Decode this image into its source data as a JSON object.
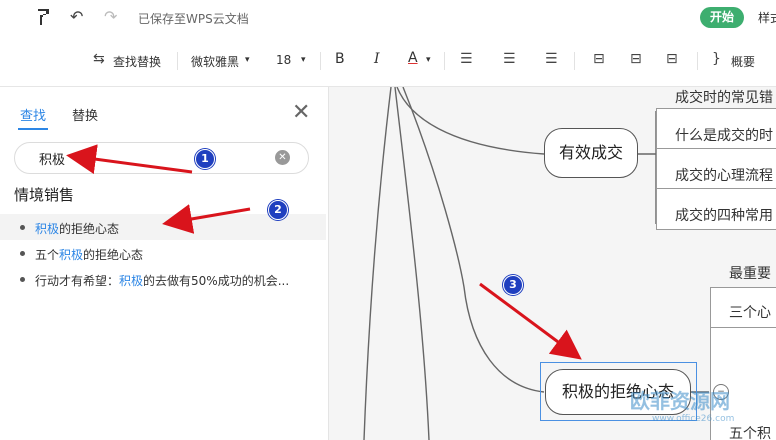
{
  "topbar": {
    "saved_status": "已保存至WPS云文档",
    "start_label": "开始",
    "style_label": "样式"
  },
  "toolbar": {
    "find_replace_label": "查找替换",
    "font_name": "微软雅黑",
    "font_size": "18",
    "bold_label": "B",
    "italic_label": "I",
    "font_color_label": "A",
    "summary_label": "概要"
  },
  "find_panel": {
    "tab_find": "查找",
    "tab_replace": "替换",
    "search_value": "积极",
    "group_title": "情境销售",
    "results": [
      {
        "before": "",
        "kw": "积极",
        "after": "的拒绝心态"
      },
      {
        "before": "五个",
        "kw": "积极",
        "after": "的拒绝心态"
      },
      {
        "before": "行动才有希望：",
        "kw": "积极",
        "after": "的去做有50%成功的机会..."
      }
    ]
  },
  "mindmap": {
    "node_effective": "有效成交",
    "leaf_1": "成交时的常见错",
    "leaf_2": "什么是成交的时",
    "leaf_3": "成交的心理流程",
    "leaf_4": "成交的四种常用",
    "node_positive": "积极的拒绝心态",
    "sub_1": "最重要",
    "sub_2": "三个心",
    "sub_3": "五个积"
  },
  "annotations": {
    "badge_1": "1",
    "badge_2": "2",
    "badge_3": "3",
    "arrow_color": "#d9141c"
  },
  "watermark": {
    "text": "欧菲资源网",
    "url": "www.office26.com"
  }
}
